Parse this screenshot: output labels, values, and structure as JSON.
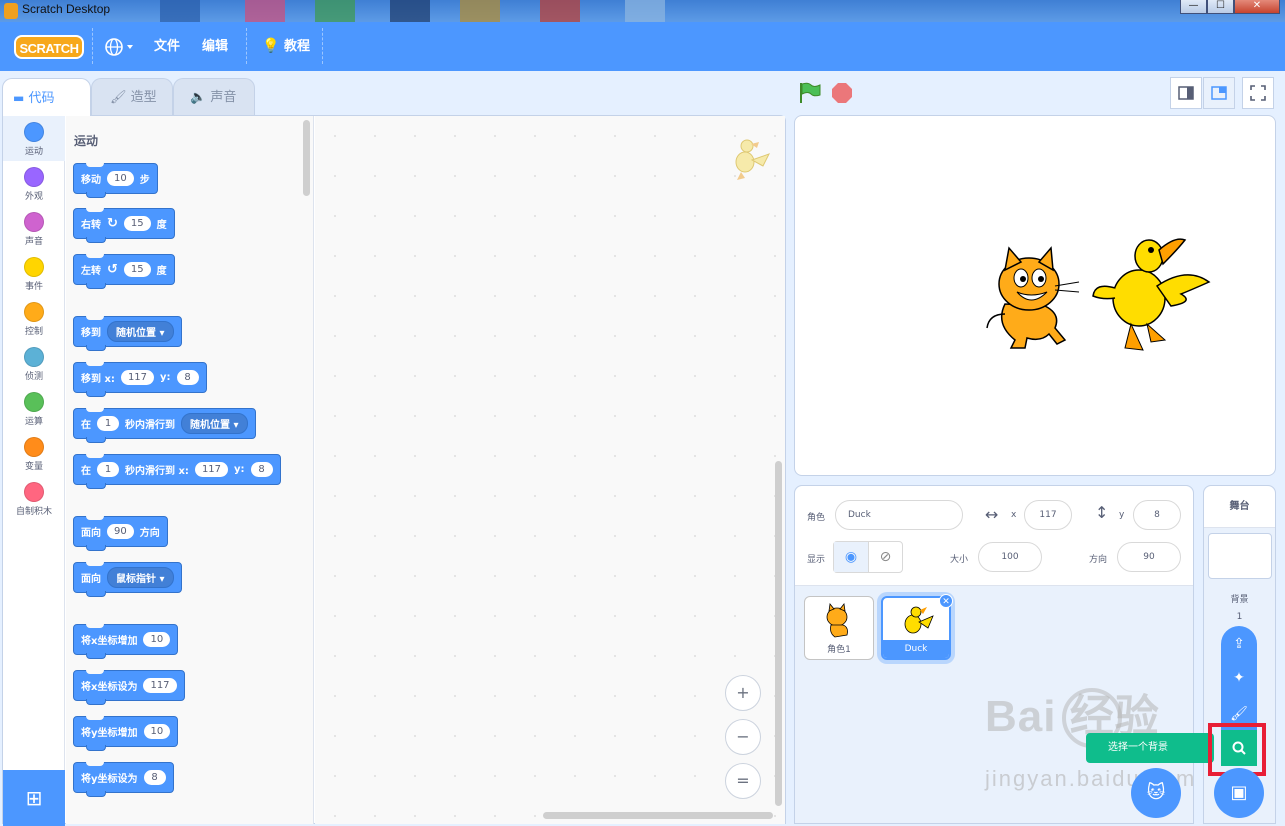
{
  "window": {
    "title": "Scratch Desktop",
    "min": "—",
    "max": "☐",
    "close": "✕"
  },
  "menubar": {
    "logo": "SCRATCH",
    "file": "文件",
    "edit": "编辑",
    "tutorials": "教程"
  },
  "tabs": {
    "code": "代码",
    "costumes": "造型",
    "sounds": "声音"
  },
  "categories": [
    {
      "label": "运动",
      "color": "#4c97ff"
    },
    {
      "label": "外观",
      "color": "#9966ff"
    },
    {
      "label": "声音",
      "color": "#cf63cf"
    },
    {
      "label": "事件",
      "color": "#ffd500"
    },
    {
      "label": "控制",
      "color": "#ffab19"
    },
    {
      "label": "侦测",
      "color": "#5cb1d6"
    },
    {
      "label": "运算",
      "color": "#59c059"
    },
    {
      "label": "变量",
      "color": "#ff8c1a"
    },
    {
      "label": "自制积木",
      "color": "#ff6680"
    }
  ],
  "palette": {
    "title": "运动",
    "move": {
      "a": "移动",
      "v": "10",
      "b": "步"
    },
    "turn_right": {
      "a": "右转",
      "v": "15",
      "b": "度"
    },
    "turn_left": {
      "a": "左转",
      "v": "15",
      "b": "度"
    },
    "goto": {
      "a": "移到",
      "drop": "随机位置"
    },
    "goto_xy": {
      "a": "移到 x:",
      "x": "117",
      "yl": "y:",
      "y": "8"
    },
    "glide": {
      "a": "在",
      "v": "1",
      "b": "秒内滑行到",
      "drop": "随机位置"
    },
    "glide_xy": {
      "a": "在",
      "v": "1",
      "b": "秒内滑行到 x:",
      "x": "117",
      "yl": "y:",
      "y": "8"
    },
    "point_dir": {
      "a": "面向",
      "v": "90",
      "b": "方向"
    },
    "point_towards": {
      "a": "面向",
      "drop": "鼠标指针"
    },
    "change_x": {
      "a": "将x坐标增加",
      "v": "10"
    },
    "set_x": {
      "a": "将x坐标设为",
      "v": "117"
    },
    "change_y": {
      "a": "将y坐标增加",
      "v": "10"
    },
    "set_y": {
      "a": "将y坐标设为",
      "v": "8"
    }
  },
  "zoom": {
    "in": "+",
    "out": "−",
    "reset": "="
  },
  "sprite_info": {
    "sprite_label": "角色",
    "sprite_name": "Duck",
    "x_label": "x",
    "x": "117",
    "y_label": "y",
    "y": "8",
    "show_label": "显示",
    "size_label": "大小",
    "size": "100",
    "direction_label": "方向",
    "direction": "90"
  },
  "sprites": [
    {
      "name": "角色1",
      "selected": false
    },
    {
      "name": "Duck",
      "selected": true
    }
  ],
  "stage_pane": {
    "title": "舞台",
    "backdrop_label": "背景",
    "backdrop_count": "1"
  },
  "tooltip": {
    "text": "选择一个背景"
  },
  "watermark": {
    "brand": "Bai 经验",
    "url": "jingyan.baidu.com"
  }
}
